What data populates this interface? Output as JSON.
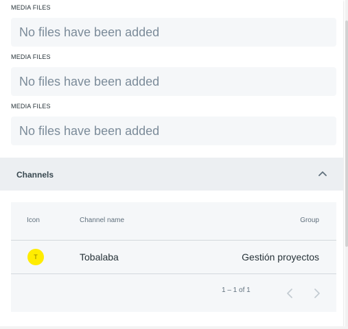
{
  "media_sections": [
    {
      "label": "MEDIA FILES",
      "empty_text": "No files have been added"
    },
    {
      "label": "MEDIA FILES",
      "empty_text": "No files have been added"
    },
    {
      "label": "MEDIA FILES",
      "empty_text": "No files have been added"
    }
  ],
  "channels": {
    "title": "Channels",
    "expanded": true,
    "toggle_icon": "chevron-up-icon",
    "table": {
      "columns": [
        "Icon",
        "Channel name",
        "Group"
      ],
      "rows": [
        {
          "icon_letter": "T",
          "icon_color": "#FFEC00",
          "channel_name": "Tobalaba",
          "group": "Gestión proyectos"
        }
      ]
    },
    "pagination": {
      "range": "1 – 1 of 1",
      "prev_icon": "chevron-left-icon",
      "next_icon": "chevron-right-icon"
    }
  },
  "colors": {
    "avatar_yellow": "#FFEC00",
    "header_bg": "#ECEFF2",
    "table_bg": "#F5F7F9"
  }
}
